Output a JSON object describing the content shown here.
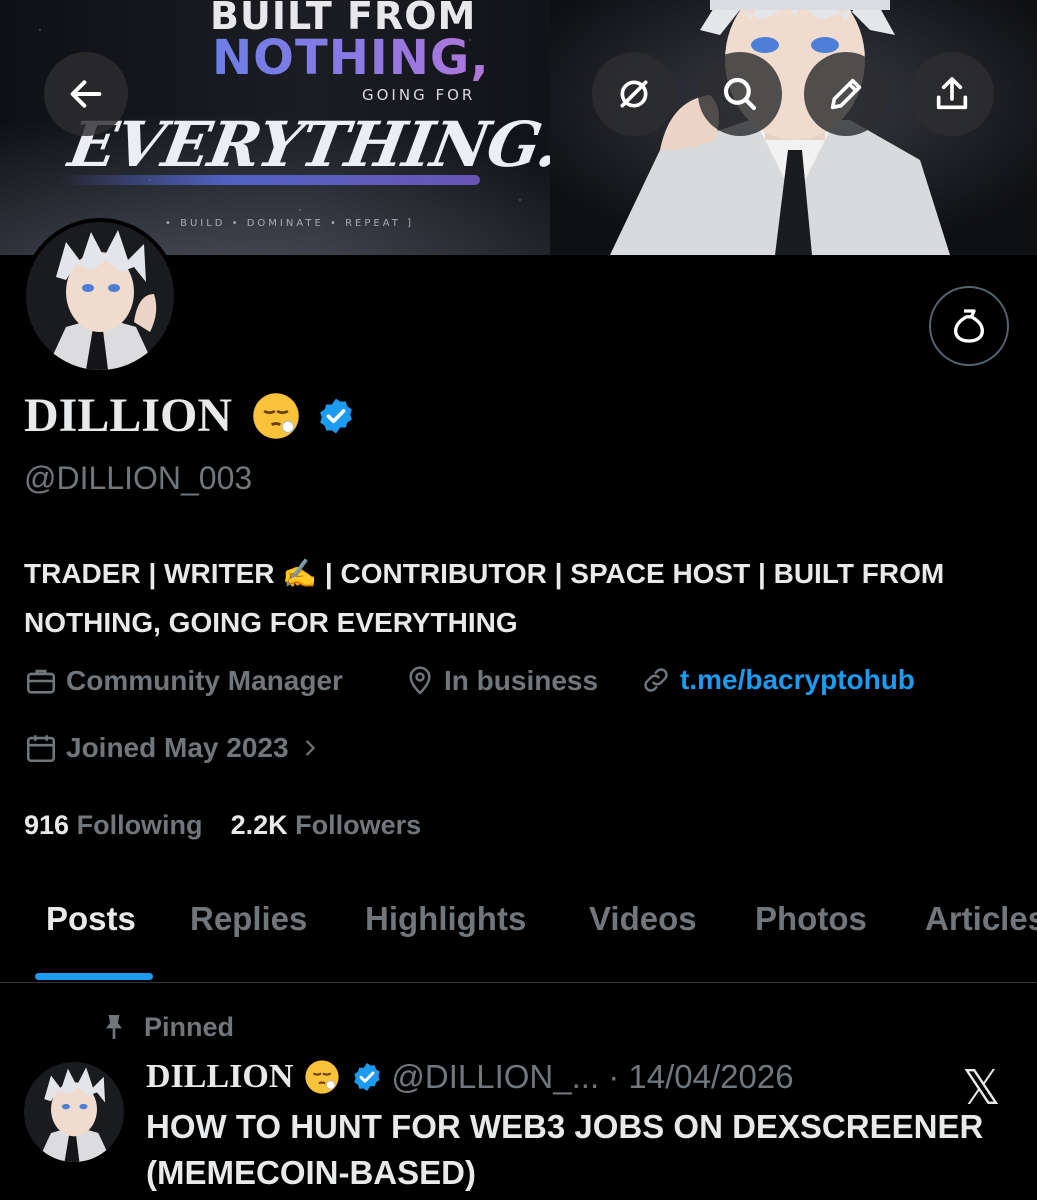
{
  "banner": {
    "line1": "BUILT FROM",
    "line2": "NOTHING,",
    "line3": "GOING FOR",
    "line4": "EVERYTHING.",
    "line5": "• BUILD  •  DOMINATE  •  REPEAT ]"
  },
  "header_icons": [
    "back-arrow-icon",
    "grok-icon",
    "search-icon",
    "edit-pencil-icon",
    "share-icon"
  ],
  "profile": {
    "name": "DILLION",
    "handle": "@DILLION_003",
    "bio": "TRADER | WRITER ✍️ | CONTRIBUTOR | SPACE HOST | BUILT FROM NOTHING, GOING FOR EVERYTHING",
    "category": "Community Manager",
    "location": "In business",
    "link": "t.me/bacryptohub",
    "joined": "Joined May 2023",
    "following_count": "916",
    "following_label": "Following",
    "followers_count": "2.2K",
    "followers_label": "Followers",
    "verified_color": "#1d9bf0"
  },
  "tabs": [
    "Posts",
    "Replies",
    "Highlights",
    "Videos",
    "Photos",
    "Articles"
  ],
  "active_tab": "Posts",
  "pinned_post": {
    "pinned_label": "Pinned",
    "author": "DILLION",
    "handle_date": "@DILLION_... · 14/04/2026",
    "title": "HOW TO HUNT FOR WEB3 JOBS ON DEXSCREENER (MEMECOIN-BASED)",
    "source_icon": "𝕏"
  },
  "colors": {
    "accent": "#1d9bf0",
    "muted": "#71767b",
    "text": "#e7e9ea",
    "bg": "#000000"
  }
}
